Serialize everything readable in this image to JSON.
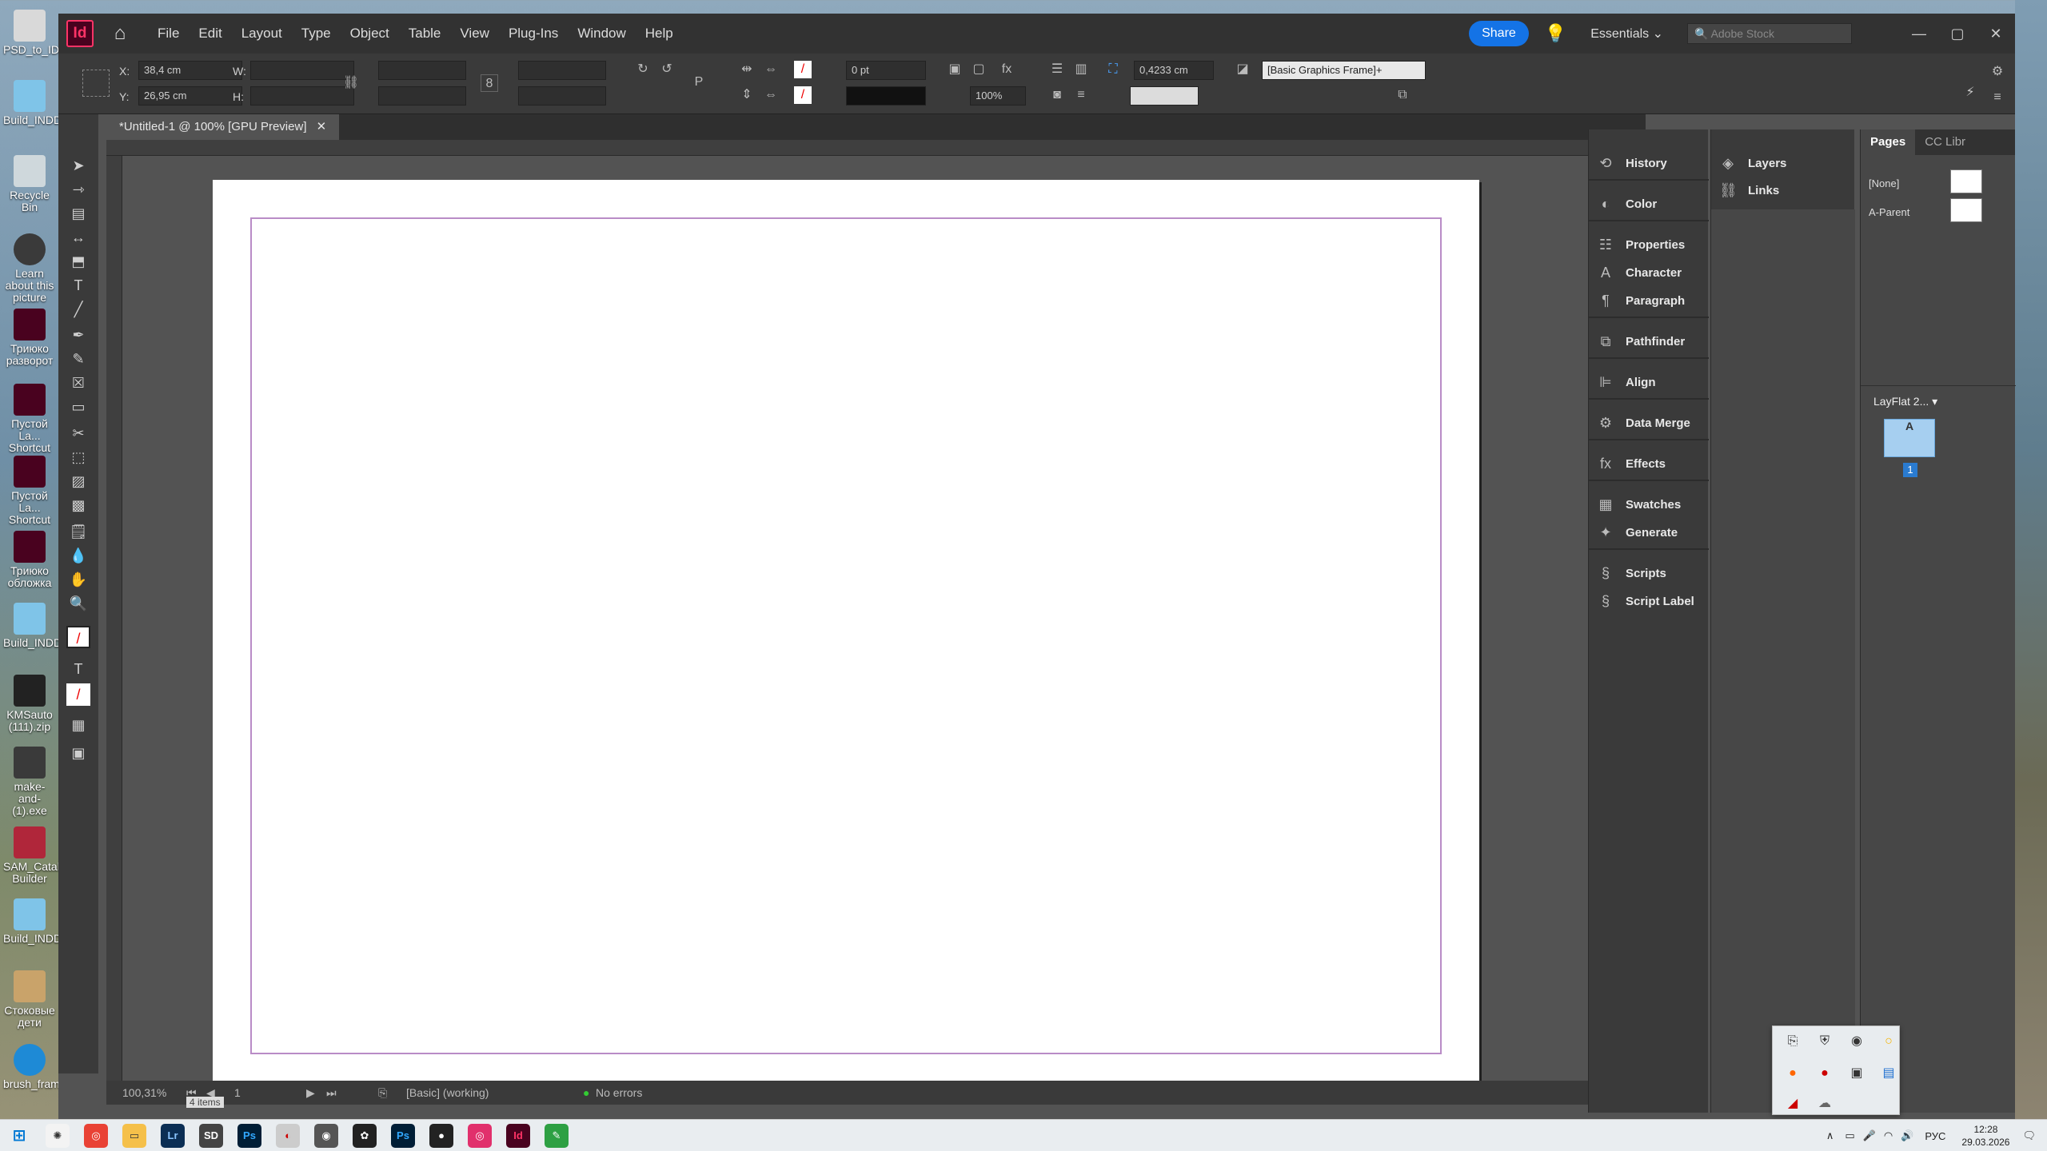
{
  "desktop": {
    "icons": [
      {
        "label": "PSD_to_ID_",
        "color": "#d9d9d9"
      },
      {
        "label": "Build_INDD",
        "color": "#7fc4e8"
      },
      {
        "label": "Recycle Bin",
        "color": "#cfd8dc"
      },
      {
        "label": "Learn about this picture",
        "color": "#3a3a3a"
      },
      {
        "label": "Триюко разворот",
        "color": "#49021f"
      },
      {
        "label": "Пустой La... Shortcut",
        "color": "#49021f"
      },
      {
        "label": "Пустой La... Shortcut",
        "color": "#49021f"
      },
      {
        "label": "Триюко обложка",
        "color": "#49021f"
      },
      {
        "label": "Build_INDD",
        "color": "#7fc4e8"
      },
      {
        "label": "KMSauto (111).zip",
        "color": "#222222"
      },
      {
        "label": "make-and- (1).exe",
        "color": "#3a3a3a"
      },
      {
        "label": "SAM_Catalo Builder",
        "color": "#b0263a"
      },
      {
        "label": "Build_INDD",
        "color": "#7fc4e8"
      },
      {
        "label": "Стоковые дети",
        "color": "#c9a36a"
      },
      {
        "label": "brush_fram.",
        "color": "#1e8ad6"
      }
    ]
  },
  "app": {
    "logo": "Id",
    "menu": [
      "File",
      "Edit",
      "Layout",
      "Type",
      "Object",
      "Table",
      "View",
      "Plug-Ins",
      "Window",
      "Help"
    ],
    "share_label": "Share",
    "workspace": "Essentials",
    "stock_placeholder": "Adobe Stock",
    "control": {
      "x_label": "X:",
      "x_value": "38,4 cm",
      "y_label": "Y:",
      "y_value": "26,95 cm",
      "w_label": "W:",
      "h_label": "H:",
      "stroke_weight": "0 pt",
      "opacity": "100%",
      "gap": "0,4233 cm",
      "object_style": "[Basic Graphics Frame]+"
    },
    "doc_tab": "*Untitled-1 @ 100% [GPU Preview]",
    "status": {
      "zoom": "100,31%",
      "page": "1",
      "preflight_profile": "[Basic] (working)",
      "errors": "No errors",
      "items": "4 items"
    },
    "dock1": [
      "History",
      "Color",
      "Properties",
      "Character",
      "Paragraph",
      "Pathfinder",
      "Align",
      "Data Merge",
      "Effects",
      "Swatches",
      "Generate",
      "Scripts",
      "Script Label"
    ],
    "dock2": [
      "Layers",
      "Links"
    ],
    "pages": {
      "tabs": [
        "Pages",
        "CC Libr"
      ],
      "masters": [
        "[None]",
        "A-Parent"
      ],
      "layflat": "LayFlat 2...",
      "spread_prefix": "A",
      "page_number": "1"
    }
  },
  "taskbar": {
    "lang": "РУС",
    "time": "12:28",
    "date": "29.03.2026"
  }
}
